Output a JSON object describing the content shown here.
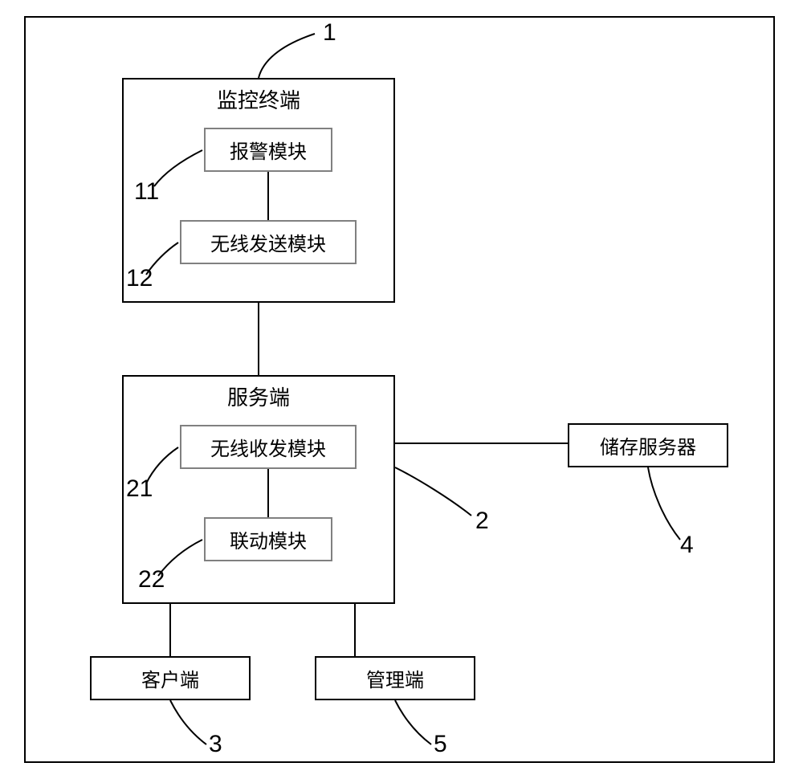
{
  "boxes": {
    "monitor_terminal": {
      "title": "监控终端",
      "label_num": "1"
    },
    "alarm_module": {
      "text": "报警模块",
      "label_num": "11"
    },
    "wireless_send_module": {
      "text": "无线发送模块",
      "label_num": "12"
    },
    "server": {
      "title": "服务端",
      "label_num": "2"
    },
    "wireless_trx_module": {
      "text": "无线收发模块",
      "label_num": "21"
    },
    "linkage_module": {
      "text": "联动模块",
      "label_num": "22"
    },
    "storage_server": {
      "text": "储存服务器",
      "label_num": "4"
    },
    "client": {
      "text": "客户端",
      "label_num": "3"
    },
    "management": {
      "text": "管理端",
      "label_num": "5"
    }
  }
}
